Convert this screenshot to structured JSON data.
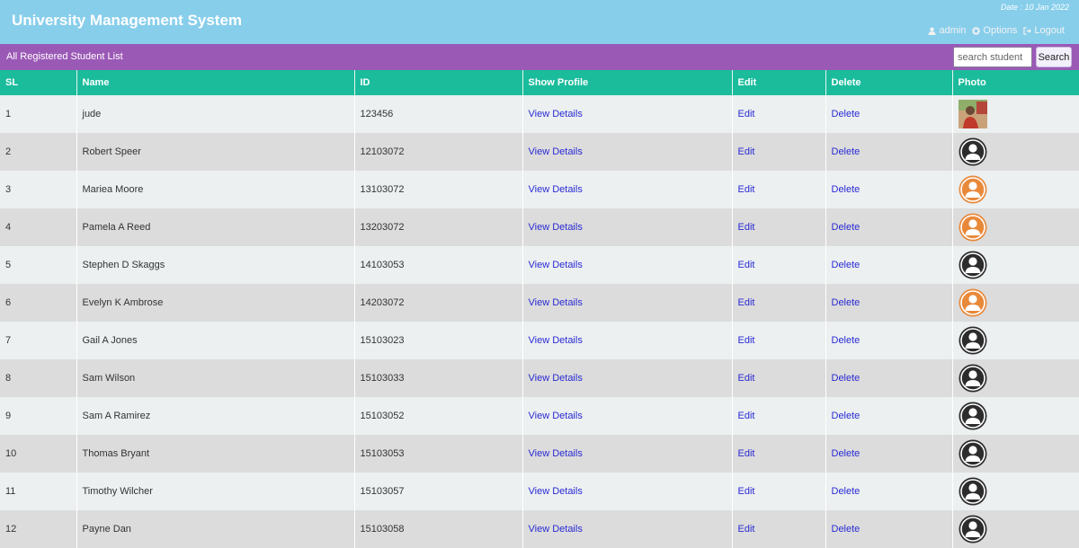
{
  "header": {
    "app_title": "University Management System",
    "date": "Date : 10 Jan 2022",
    "nav": {
      "admin": "admin",
      "options": "Options",
      "logout": "Logout"
    }
  },
  "toolbar": {
    "title": "All Registered Student List",
    "search_placeholder": "search student",
    "search_button": "Search"
  },
  "table": {
    "columns": [
      "SL",
      "Name",
      "ID",
      "Show Profile",
      "Edit",
      "Delete",
      "Photo"
    ],
    "link_labels": {
      "view": "View Details",
      "edit": "Edit",
      "delete": "Delete"
    },
    "rows": [
      {
        "sl": "1",
        "name": "jude",
        "id": "123456",
        "photo": "photo"
      },
      {
        "sl": "2",
        "name": "Robert Speer",
        "id": "12103072",
        "photo": "male"
      },
      {
        "sl": "3",
        "name": "Mariea Moore",
        "id": "13103072",
        "photo": "female"
      },
      {
        "sl": "4",
        "name": "Pamela A Reed",
        "id": "13203072",
        "photo": "female"
      },
      {
        "sl": "5",
        "name": "Stephen D Skaggs",
        "id": "14103053",
        "photo": "male"
      },
      {
        "sl": "6",
        "name": "Evelyn K Ambrose",
        "id": "14203072",
        "photo": "female"
      },
      {
        "sl": "7",
        "name": "Gail A Jones",
        "id": "15103023",
        "photo": "male"
      },
      {
        "sl": "8",
        "name": "Sam Wilson",
        "id": "15103033",
        "photo": "male"
      },
      {
        "sl": "9",
        "name": "Sam A Ramirez",
        "id": "15103052",
        "photo": "male"
      },
      {
        "sl": "10",
        "name": "Thomas Bryant",
        "id": "15103053",
        "photo": "male"
      },
      {
        "sl": "11",
        "name": "Timothy Wilcher",
        "id": "15103057",
        "photo": "male"
      },
      {
        "sl": "12",
        "name": "Payne Dan",
        "id": "15103058",
        "photo": "male"
      }
    ]
  },
  "colors": {
    "header_bg": "#87ceeb",
    "toolbar_bg": "#9b59b6",
    "table_header_bg": "#1abc9c",
    "link": "#2a2ad4",
    "avatar_dark": "#2c2c2c",
    "avatar_orange": "#e8893a"
  },
  "icons": {
    "admin": "user-icon",
    "options": "gear-icon",
    "logout": "logout-icon"
  }
}
